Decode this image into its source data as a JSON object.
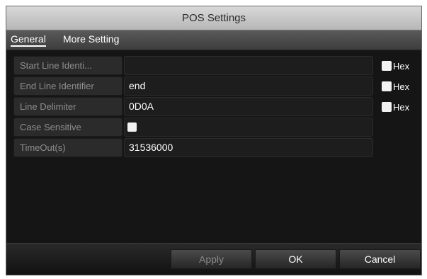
{
  "dialog": {
    "title": "POS Settings"
  },
  "tabs": [
    {
      "label": "General",
      "active": true
    },
    {
      "label": "More Setting",
      "active": false
    }
  ],
  "fields": [
    {
      "label": "Start Line Identi...",
      "value": ""
    },
    {
      "label": "End Line Identifier",
      "value": "end"
    },
    {
      "label": "Line Delimiter",
      "value": "0D0A"
    },
    {
      "label": "Case Sensitive",
      "value": ""
    },
    {
      "label": "TimeOut(s)",
      "value": "31536000"
    }
  ],
  "hex_options": [
    {
      "label": "Hex",
      "checked": false
    },
    {
      "label": "Hex",
      "checked": false
    },
    {
      "label": "Hex",
      "checked": false
    }
  ],
  "case_sensitive": {
    "checked": false
  },
  "buttons": {
    "apply": "Apply",
    "ok": "OK",
    "cancel": "Cancel"
  }
}
